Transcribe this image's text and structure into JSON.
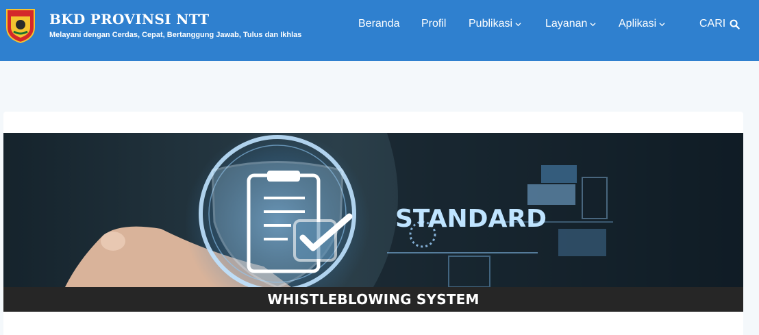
{
  "header": {
    "title": "BKD PROVINSI NTT",
    "tagline": "Melayani dengan Cerdas, Cepat, Bertanggung Jawab, Tulus dan Ikhlas",
    "logo_icon": "provincial-crest-icon",
    "bg_color": "#2f80cf"
  },
  "nav": {
    "items": [
      {
        "label": "Beranda",
        "dropdown": false
      },
      {
        "label": "Profil",
        "dropdown": false
      },
      {
        "label": "Publikasi",
        "dropdown": true
      },
      {
        "label": "Layanan",
        "dropdown": true
      },
      {
        "label": "Aplikasi",
        "dropdown": true
      }
    ],
    "search_label": "CARI",
    "search_icon": "search-icon"
  },
  "banner": {
    "image_text": "STANDARD",
    "caption": "WHISTLEBLOWING SYSTEM"
  }
}
